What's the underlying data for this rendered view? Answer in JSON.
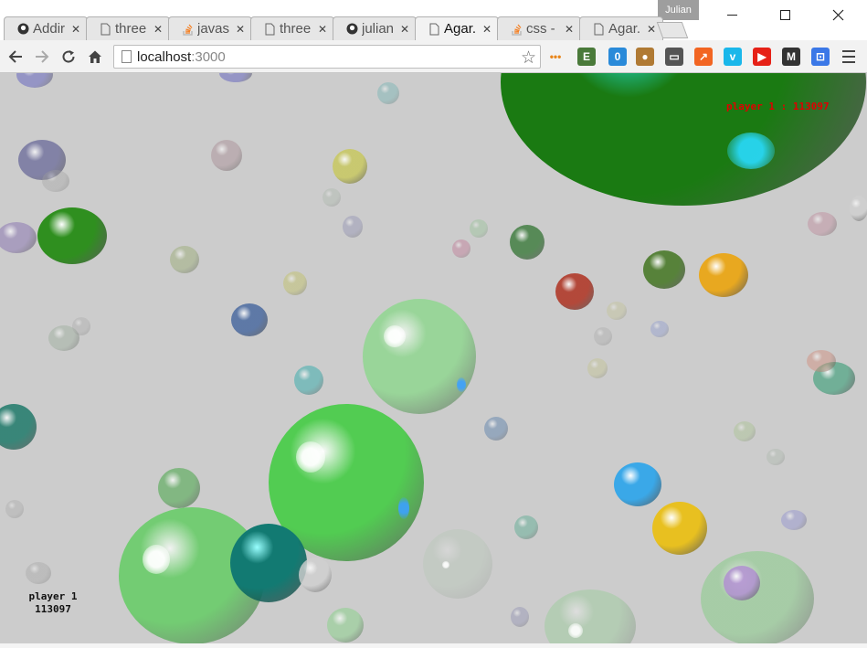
{
  "window": {
    "profile_name": "Julian"
  },
  "tabs": [
    {
      "title": "Addir",
      "icon": "github-icon",
      "active": false
    },
    {
      "title": "three",
      "icon": "page-icon",
      "active": false
    },
    {
      "title": "javas",
      "icon": "stackoverflow-icon",
      "active": false
    },
    {
      "title": "three",
      "icon": "page-icon",
      "active": false
    },
    {
      "title": "julian",
      "icon": "github-icon",
      "active": false
    },
    {
      "title": "Agar.",
      "icon": "page-icon",
      "active": true
    },
    {
      "title": "css -",
      "icon": "stackoverflow-icon",
      "active": false
    },
    {
      "title": "Agar.",
      "icon": "page-icon",
      "active": false
    }
  ],
  "address_bar": {
    "host": "localhost",
    "port": ":3000"
  },
  "extensions": [
    {
      "name": "more-dots-icon",
      "color": "#e8851a",
      "glyph": "•••"
    },
    {
      "name": "evernote-icon",
      "color": "#4a7a3a",
      "glyph": "E"
    },
    {
      "name": "ghostery-icon",
      "color": "#2a8ad9",
      "glyph": "0"
    },
    {
      "name": "cookie-icon",
      "color": "#b07a34",
      "glyph": "●"
    },
    {
      "name": "cast-icon",
      "color": "#555555",
      "glyph": "▭"
    },
    {
      "name": "analytics-icon",
      "color": "#f26522",
      "glyph": "↗"
    },
    {
      "name": "vimeo-icon",
      "color": "#1ab7ea",
      "glyph": "v"
    },
    {
      "name": "youtube-icon",
      "color": "#e62117",
      "glyph": "▶"
    },
    {
      "name": "medium-icon",
      "color": "#333333",
      "glyph": "M"
    },
    {
      "name": "tab-extension-icon",
      "color": "#3b78e7",
      "glyph": "⊡"
    }
  ],
  "game": {
    "hud_top": "player 1 : 113097",
    "hud_bottom_name": "player 1",
    "hud_bottom_score": "113097"
  }
}
